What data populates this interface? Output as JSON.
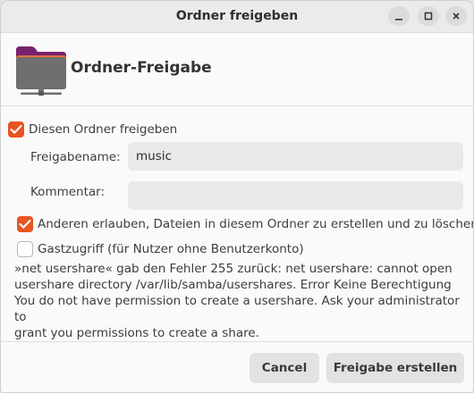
{
  "window": {
    "title": "Ordner freigeben"
  },
  "header": {
    "title": "Ordner-Freigabe",
    "icon": "folder-remote-icon"
  },
  "share_folder": {
    "label": "Diesen Ordner freigeben",
    "checked": true
  },
  "share_name": {
    "label": "Freigabename:",
    "value": "music"
  },
  "comment": {
    "label": "Kommentar:",
    "value": ""
  },
  "allow_others": {
    "label": "Anderen erlauben, Dateien in diesem Ordner zu erstellen und zu löschen",
    "checked": true
  },
  "guest_access": {
    "label": "Gastzugriff (für Nutzer ohne Benutzerkonto)",
    "checked": false
  },
  "error": {
    "lines": [
      "»net usershare« gab den Fehler 255 zurück: net usershare: cannot open",
      "usershare directory /var/lib/samba/usershares. Error Keine Berechtigung",
      "You do not have permission to create a usershare. Ask your administrator to",
      "grant you permissions to create a share."
    ]
  },
  "buttons": {
    "cancel": "Cancel",
    "create": "Freigabe erstellen"
  },
  "colors": {
    "accent": "#e95420",
    "folder": "#77216f"
  }
}
